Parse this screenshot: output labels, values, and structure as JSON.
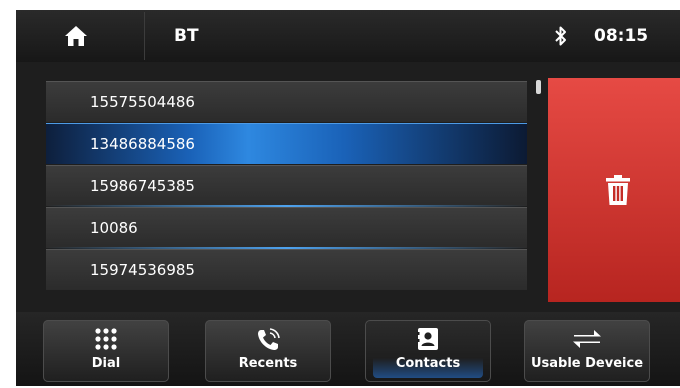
{
  "header": {
    "title": "BT",
    "time": "08:15",
    "home_icon": "home-icon",
    "status_icon": "bluetooth-icon"
  },
  "contacts": [
    {
      "number": "15575504486",
      "selected": false
    },
    {
      "number": "13486884586",
      "selected": true
    },
    {
      "number": "15986745385",
      "selected": false
    },
    {
      "number": "10086",
      "selected": false
    },
    {
      "number": "15974536985",
      "selected": false
    }
  ],
  "delete_button": {
    "icon": "trash-icon"
  },
  "nav": {
    "dial": {
      "label": "Dial",
      "icon": "keypad-icon"
    },
    "recents": {
      "label": "Recents",
      "icon": "phone-call-icon"
    },
    "contacts": {
      "label": "Contacts",
      "icon": "contact-card-icon"
    },
    "usable_device": {
      "label": "Usable Deveice",
      "icon": "swap-arrows-icon"
    }
  },
  "colors": {
    "accent_blue": "#2e88e0",
    "delete_red": "#d6362f",
    "background": "#1e1e1e"
  }
}
